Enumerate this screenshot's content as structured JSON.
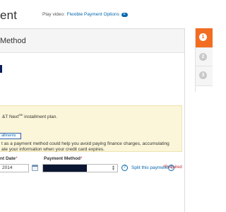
{
  "header": {
    "title": "ent",
    "video_prefix": "Play video:",
    "video_link": "Flexible Payment Options"
  },
  "panel": {
    "title": "Method"
  },
  "notice": {
    "line1_text": "&T Next",
    "line1_sup": "sm",
    "line1_suffix": " installment plan.",
    "installments_button": "allments",
    "line2": "t as a payment method could help you avoid paying finance charges, accumulating",
    "line3": "ate your information when your credit card expires."
  },
  "form": {
    "required_label": "*Required",
    "date_label": "nt Date",
    "method_label": "Payment Method",
    "asterisk": "*",
    "date_value": "2014",
    "split_link": "Split this payment"
  },
  "steps": [
    {
      "number": "1",
      "active": true
    },
    {
      "number": "2",
      "active": false
    },
    {
      "number": "3",
      "active": false
    }
  ],
  "colors": {
    "accent_orange": "#f26d21",
    "link_blue": "#0568ae",
    "notice_bg": "#fbf6d9",
    "required_red": "#c4262e"
  }
}
